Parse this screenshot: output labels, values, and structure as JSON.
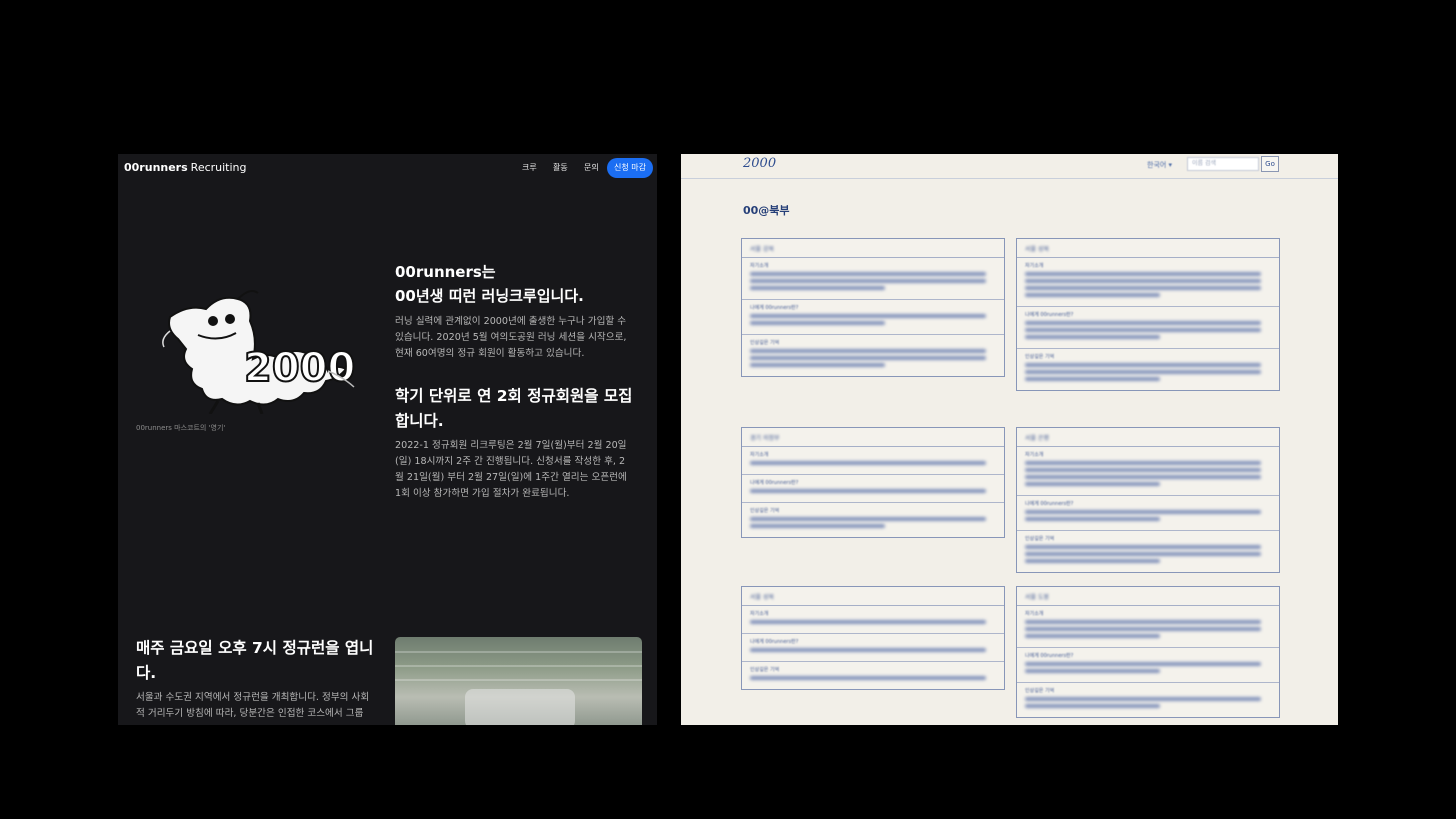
{
  "left_panel": {
    "nav": {
      "brand_bold": "00runners",
      "brand_light": "Recruiting",
      "links": [
        "크루",
        "활동",
        "문의"
      ],
      "cta": "신청 마감"
    },
    "mascot_caption": "00runners 마스코트의 '영기'",
    "intro": {
      "heading_line1": "00runners는",
      "heading_line2": "00년생 띠런 러닝크루입니다.",
      "lines": [
        "러닝 실력에 관계없이 2000년에 출생한 누구나 가입할 수",
        "있습니다. 2020년 5월 여의도공원 러닝 세션을 시작으로,",
        "현재 60여명의 정규 회원이 활동하고 있습니다."
      ]
    },
    "recruit": {
      "heading_line1": "학기 단위로 연 2회 정규회원을 모집",
      "heading_line2": "합니다.",
      "lines": [
        "2022-1 정규회원 리크루팅은 2월 7일(월)부터 2월 20일",
        "(일) 18시까지 2주 간 진행됩니다. 신청서를 작성한 후, 2",
        "월 21일(월) 부터 2월 27일(일)에 1주간 열리는 오픈런에",
        "1회 이상 참가하면 가입 절차가 완료됩니다."
      ]
    },
    "weekly": {
      "heading_line1": "매주 금요일 오후 7시 정규런을 엽니",
      "heading_line2": "다.",
      "lines": [
        "서울과 수도권 지역에서 정규런을 개최합니다. 정부의 사회",
        "적 거리두기 방침에 따라, 당분간은 인접한 코스에서 그룹"
      ]
    },
    "colors": {
      "bg": "#17171a",
      "accent": "#1b6ef3"
    }
  },
  "right_panel": {
    "logo": "2000",
    "lang": "한국어 ▾",
    "search_placeholder": "이름 검색",
    "go_label": "Go",
    "title": "00@북부",
    "cards": [
      {
        "title": "서울 강북",
        "sections": [
          "자기소개",
          "나에게 00runners란?",
          "인상깊은 기억"
        ]
      },
      {
        "title": "서울 성북",
        "sections": [
          "자기소개",
          "나에게 00runners란?",
          "인상깊은 기억"
        ]
      },
      {
        "title": "경기 의정부",
        "sections": [
          "자기소개",
          "나에게 00runners란?",
          "인상깊은 기억"
        ]
      },
      {
        "title": "서울 은평",
        "sections": [
          "자기소개",
          "나에게 00runners란?",
          "인상깊은 기억"
        ]
      },
      {
        "title": "서울 성북",
        "sections": [
          "자기소개",
          "나에게 00runners란?",
          "인상깊은 기억"
        ]
      },
      {
        "title": "서울 도봉",
        "sections": [
          "자기소개",
          "나에게 00runners란?",
          "인상깊은 기억"
        ]
      }
    ],
    "colors": {
      "bg": "#f2efe8",
      "ink": "#243a6b"
    }
  }
}
